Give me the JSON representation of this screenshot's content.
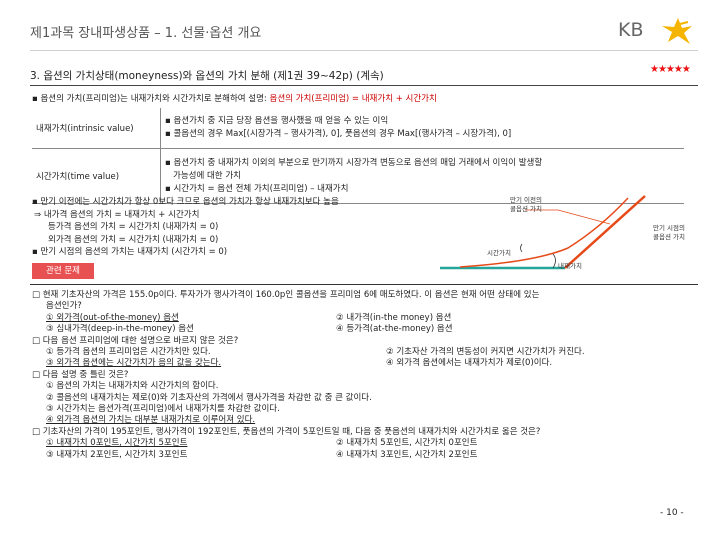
{
  "header": {
    "title": "제1과목 장내파생상품 – 1. 선물·옵션 개요",
    "logo_text": "KB",
    "logo_accent": "#f5b400"
  },
  "section": {
    "title": "3. 옵션의 가치상태(moneyness)와 옵션의 가치 분해 (제1권 39~42p) (계속)",
    "stars": "★★★★★"
  },
  "intro": {
    "text": "▪ 옵션의 가치(프리미엄)는 내재가치와 시간가치로 분해하여 설명: ",
    "highlight": "옵션의 가치(프리미엄) = 내재가치 + 시간가치"
  },
  "table": [
    {
      "term": "내재가치(intrinsic value)",
      "lines": [
        "▪ 옵션가치 중 지금 당장 옵션을 행사했을 때 얻을 수 있는 이익",
        "▪ 콜옵션의 경우 Max[(시장가격 – 행사가격), 0], 풋옵션의 경우 Max[(행사가격 – 시장가격), 0]"
      ]
    },
    {
      "term": "시간가치(time value)",
      "lines": [
        "▪ 옵션가치 중 내재가치 이외의 부분으로 만기까지 시장가격 변동으로 옵션의 매입 거래에서 이익이 발생할",
        "가능성에 대한 가치",
        "▪ 시간가치 = 옵션 전체 가치(프리미엄) – 내재가치"
      ]
    }
  ],
  "notes": [
    "▪ 만기 이전에는 시간가치가 항상 0보다 크므로 옵션의 가치가 항상 내재가치보다 높음",
    "⇒ 내가격 옵션의 가치 = 내재가치 + 시간가치",
    "등가격 옵션의 가치 = 시간가치 (내재가치 = 0)",
    "외가격 옵션의 가치 = 시간가치 (내재가치 = 0)",
    "▪ 만기 시점의 옵션의 가치는 내재가치 (시간가치 = 0)"
  ],
  "related_label": "관련 문제",
  "chart": {
    "label_before": [
      "만기 이전의",
      "콜옵션 가치"
    ],
    "label_expiry": [
      "만기 시점의",
      "콜옵션 가치"
    ],
    "label_time": "시간가치",
    "label_intrinsic": "내재가치",
    "colors": {
      "before": "#e64a19",
      "expiry": "#e64a19",
      "axis": "#26a69a"
    }
  },
  "questions": [
    {
      "lines": [
        "□ 현재 기초자산의 가격은 155.0p이다. 투자가가 행사가격이 160.0p인 콜옵션을 프리미엄 6에 매도하였다. 이 옵션은 현재 어떤 상태에 있는",
        "옵션인가?"
      ],
      "options": [
        [
          "① 외가격(out-of-the-money) 옵션",
          "② 내가격(in-the money) 옵션"
        ],
        [
          "③ 심내가격(deep-in-the-money) 옵션",
          "④ 등가격(at-the-money) 옵션"
        ]
      ]
    },
    {
      "lines": [
        "□ 다음 옵션 프리미엄에 대한 설명으로 바르지 않은 것은?"
      ],
      "options": [
        [
          "① 등가격 옵션의 프리미엄은 시간가치만 있다.",
          "② 기초자산 가격의 변동성이 커지면 시간가치가 커진다."
        ],
        [
          "③ 외가격 옵션에는 시간가치가 음의 값을 갖는다.",
          "④ 외가격 옵션에서는 내재가치가 제로(0)이다."
        ]
      ]
    },
    {
      "lines": [
        "□ 다음 설명 중 틀린 것은?"
      ],
      "items": [
        "① 옵션의 가치는 내재가치와 시간가치의 합이다.",
        "② 콜옵션의 내재가치는 제로(0)와 기초자산의 가격에서 행사가격을 차감한 값 중 큰 값이다.",
        "③ 시간가치는 옵션가격(프리미엄)에서 내재가치를 차감한 값이다.",
        "④ 외가격 옵션의 가치는 대부분 내재가치로 이루어져 있다."
      ]
    },
    {
      "lines": [
        "□ 기초자산의 가격이 195포인트, 행사가격이 192포인트, 풋옵션의 가격이 5포인트일 때, 다음 중 풋옵션의 내재가치와 시간가치로 옳은 것은?"
      ],
      "options": [
        [
          "① 내재가치 0포인트, 시간가치 5포인트",
          "② 내재가치 5포인트, 시간가치 0포인트"
        ],
        [
          "③ 내재가치 2포인트, 시간가치 3포인트",
          "④ 내재가치 3포인트, 시간가치 2포인트"
        ]
      ]
    }
  ],
  "page_number": "- 10 -"
}
